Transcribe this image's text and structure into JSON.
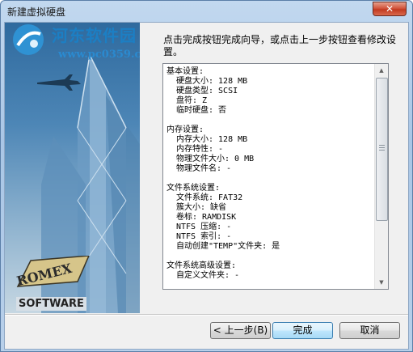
{
  "window": {
    "title": "新建虚拟硬盘",
    "close_label": "✕"
  },
  "watermark": {
    "title": "河东软件园",
    "url": "www.pc0359.cn"
  },
  "branding": {
    "logo_word": "ROMEX",
    "logo_subword": "SOFTWARE"
  },
  "instruction": "点击完成按钮完成向导，或点击上一步按钮查看修改设置。",
  "summary": {
    "sections": [
      {
        "header": "基本设置:",
        "lines": [
          "硬盘大小: 128 MB",
          "硬盘类型: SCSI",
          "盘符: Z",
          "临时硬盘: 否"
        ]
      },
      {
        "header": "内存设置:",
        "lines": [
          "内存大小: 128 MB",
          "内存特性: -",
          "物理文件大小: 0 MB",
          "物理文件名: -"
        ]
      },
      {
        "header": "文件系统设置:",
        "lines": [
          "文件系统: FAT32",
          "簇大小: 缺省",
          "卷标: RAMDISK",
          "NTFS 压缩: -",
          "NTFS 索引: -",
          "自动创建\"TEMP\"文件夹: 是"
        ]
      },
      {
        "header": "文件系统高级设置:",
        "lines": [
          "自定义文件夹: -"
        ]
      }
    ]
  },
  "buttons": {
    "back": "< 上一步(B)",
    "finish": "完成",
    "cancel": "取消"
  }
}
